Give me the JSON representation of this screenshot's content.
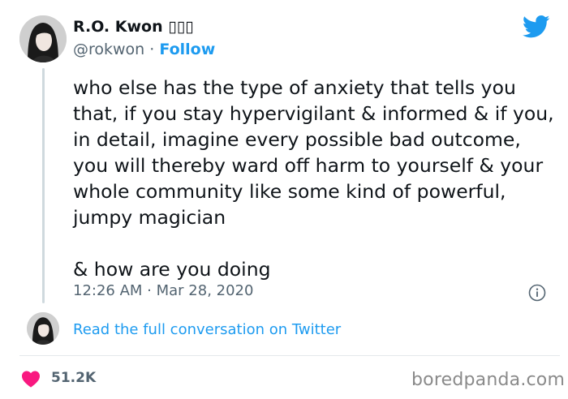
{
  "author": {
    "display_name": "R.O. Kwon ▯▯▯",
    "handle": "@rokwon",
    "separator": " · ",
    "follow_label": "Follow"
  },
  "icons": {
    "brand": "twitter-bird-icon",
    "info": "info-icon",
    "like": "heart-icon",
    "brand_color": "#1d9bf0",
    "like_color": "#f91880"
  },
  "tweet": {
    "paragraphs": [
      "who else has the type of anxiety that tells you that, if you stay hypervigilant & informed & if you, in detail, imagine every possible bad outcome, you will thereby ward off harm to yourself & your whole community like some kind of powerful, jumpy magician",
      "& how are you doing"
    ],
    "timestamp": "12:26 AM · Mar 28, 2020"
  },
  "conversation_link": "Read the full conversation on Twitter",
  "likes": "51.2K",
  "watermark": "boredpanda.com"
}
